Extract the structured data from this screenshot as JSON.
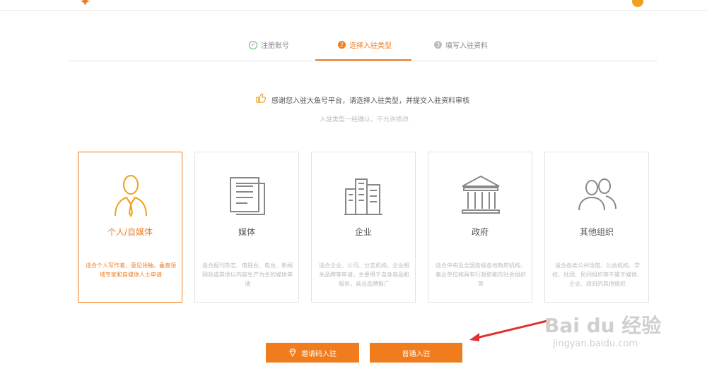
{
  "steps": [
    {
      "num": "✓",
      "label": "注册账号"
    },
    {
      "num": "2",
      "label": "选择入驻类型"
    },
    {
      "num": "3",
      "label": "填写入驻资料"
    }
  ],
  "notice": {
    "main": "感谢您入驻大鱼号平台，请选择入驻类型，并提交入驻资料审核",
    "sub": "入驻类型一经确认，不允许修改"
  },
  "cards": [
    {
      "title": "个人/自媒体",
      "desc": "适合个人写作者、意见领袖、垂直领域专家和自媒体人士申请",
      "icon": "person-tie-icon"
    },
    {
      "title": "媒体",
      "desc": "适合报刊杂志、电视台、电台、新闻网站或其他以内容生产为主的媒体申请",
      "icon": "document-icon"
    },
    {
      "title": "企业",
      "desc": "适合企业、公司、分支机构、企业相关品牌等申请，主要用于自身商品和服务，商业品牌推广",
      "icon": "buildings-icon"
    },
    {
      "title": "政府",
      "desc": "适合中央及全国各级各地政府机构、事业单位和具有行政职能的社会组织等",
      "icon": "government-building-icon"
    },
    {
      "title": "其他组织",
      "desc": "适合各类公共场馆、公益机构、学校、社团、民间组织等不属于媒体、企业、政府的其他组织",
      "icon": "group-icon"
    }
  ],
  "buttons": {
    "invite": "邀请码入驻",
    "normal": "普通入驻"
  },
  "watermark": {
    "big": "Bai du 经验",
    "small": "jingyan.baidu.com"
  },
  "colors": {
    "accent": "#f07c1e",
    "success": "#6bb56b"
  }
}
